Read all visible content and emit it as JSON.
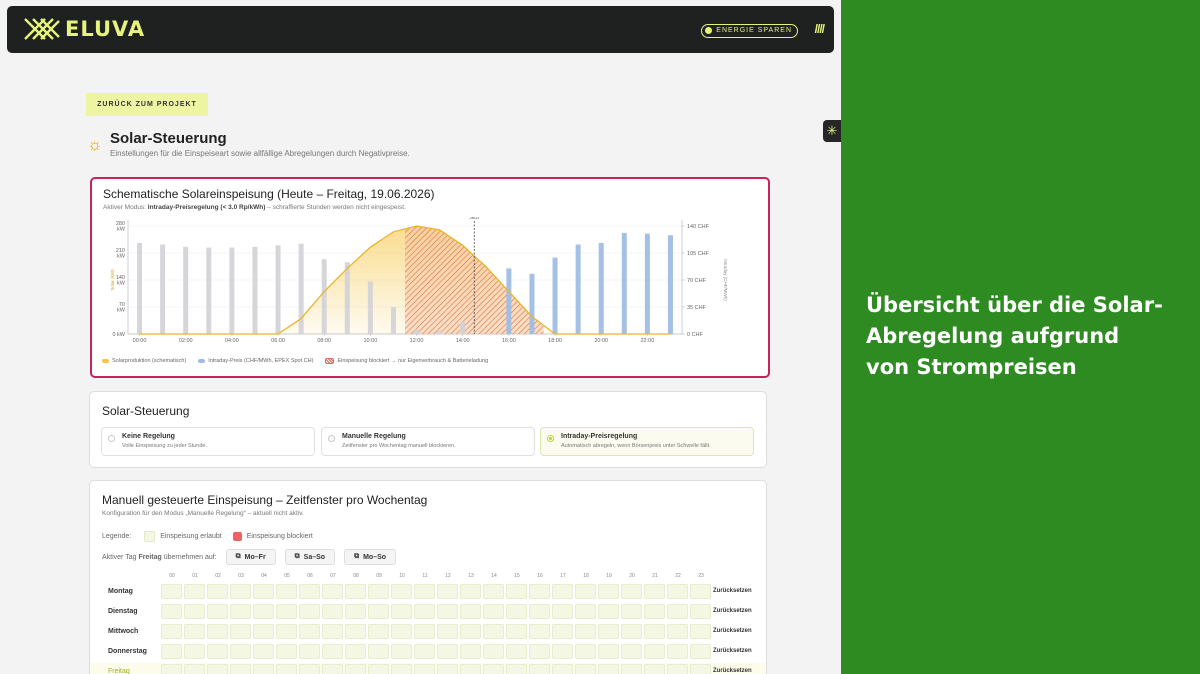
{
  "header": {
    "brand": "ELUVA",
    "badge": "ENERGIE SPAREN",
    "slashes": "////"
  },
  "back_button": "ZURÜCK ZUM PROJEKT",
  "page": {
    "title": "Solar-Steuerung",
    "subtitle": "Einstellungen für die Einspeiseart sowie allfällige Abregelungen durch Negativpreise."
  },
  "chart_card": {
    "title": "Schematische Solareinspeisung (Heute – Freitag, 19.06.2026)",
    "mode_prefix": "Aktiver Modus: ",
    "mode_name": "Intraday-Preisregelung (< 3.0 Rp/kWh)",
    "mode_suffix": " – schraffierte Stunden werden nicht eingespeist.",
    "legend": [
      "Solarproduktion (schematisch)",
      "Intraday-Preis (CHF/MWh, EPEX Spot CH)",
      "Einspeisung blockiert → nur Eigenverbrauch & Batterieladung"
    ]
  },
  "chart_data": {
    "type": "bar",
    "x_labels": [
      "00:00",
      "02:00",
      "04:00",
      "06:00",
      "08:00",
      "10:00",
      "12:00",
      "14:00",
      "16:00",
      "18:00",
      "20:00",
      "22:00"
    ],
    "left_ticks": [
      "280 kW",
      "210 kW",
      "140 kW",
      "70 kW",
      "0 kW"
    ],
    "right_ticks": [
      "140 CHF",
      "105 CHF",
      "70 CHF",
      "35 CHF",
      "0 CHF"
    ],
    "left_axis_label": "Solar (kW)",
    "right_axis_label": "Intraday (CHF/MWh)",
    "now_label": "Jetzt",
    "now_hour": 15,
    "ylim_price": [
      0,
      140
    ],
    "ylim_solar": [
      0,
      280
    ],
    "price_series": {
      "name": "Intraday-Preis (CHF/MWh, EPEX Spot CH)",
      "values": [
        118,
        116,
        113,
        112,
        112,
        113,
        115,
        117,
        97,
        93,
        68,
        35,
        6,
        5,
        16,
        0,
        85,
        78,
        99,
        116,
        118,
        131,
        130,
        128
      ]
    },
    "solar_series": {
      "name": "Solarproduktion (schematisch)",
      "values": [
        0,
        0,
        0,
        0,
        0,
        0,
        0,
        40,
        110,
        170,
        225,
        265,
        280,
        270,
        230,
        175,
        110,
        45,
        0,
        0,
        0,
        0,
        0,
        0
      ]
    },
    "blocked_hours": [
      12,
      13,
      14,
      15,
      16,
      17
    ],
    "colors": {
      "solar": "#f5c545",
      "price": "#9fbde4",
      "price_past": "#d1d1d6",
      "blocked": "#e06a5a"
    }
  },
  "control": {
    "title": "Solar-Steuerung",
    "options": [
      {
        "title": "Keine Regelung",
        "desc": "Volle Einspeisung zu jeder Stunde.",
        "selected": false
      },
      {
        "title": "Manuelle Regelung",
        "desc": "Zeitfenster pro Wochentag manuell blockieren.",
        "selected": false
      },
      {
        "title": "Intraday-Preisregelung",
        "desc": "Automatisch abregeln, wenn Börsenpreis unter Schwelle fällt.",
        "selected": true
      }
    ]
  },
  "manual": {
    "title": "Manuell gesteuerte Einspeisung – Zeitfenster pro Wochentag",
    "subtitle": "Konfiguration für den Modus „Manuelle Regelung“ – aktuell nicht aktiv.",
    "legend_label": "Legende:",
    "legend_allowed": "Einspeisung erlaubt",
    "legend_blocked": "Einspeisung blockiert",
    "copy_prefix": "Aktiver Tag ",
    "copy_day": "Freitag",
    "copy_suffix": " übernehmen auf:",
    "copy_buttons": [
      "Mo–Fr",
      "Sa–So",
      "Mo–So"
    ],
    "hours": [
      "00",
      "01",
      "02",
      "03",
      "04",
      "05",
      "06",
      "07",
      "08",
      "09",
      "10",
      "11",
      "12",
      "13",
      "14",
      "15",
      "16",
      "17",
      "18",
      "19",
      "20",
      "21",
      "22",
      "23"
    ],
    "days": [
      "Montag",
      "Dienstag",
      "Mittwoch",
      "Donnerstag",
      "Freitag"
    ],
    "active_day": "Freitag",
    "reset_label": "Zurücksetzen"
  },
  "promo": {
    "headline": "Übersicht über die Solar-\nAbregelung aufgrund\nvon Strompreisen"
  }
}
